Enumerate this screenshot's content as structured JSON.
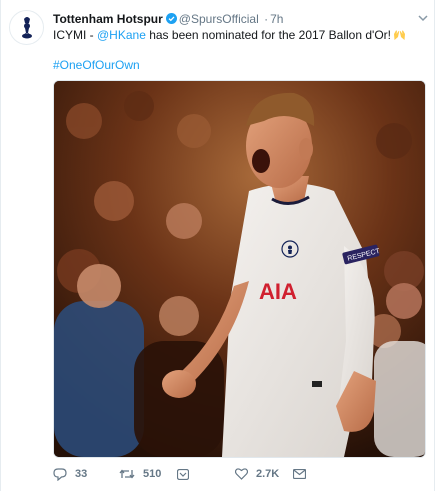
{
  "tweet": {
    "display_name": "Tottenham Hotspur",
    "handle": "@SpursOfficial",
    "separator": "·",
    "time": "7h",
    "text_prefix": "ICYMI - ",
    "mention": "@HKane",
    "text_suffix": " has been nominated for the 2017 Ballon d'Or!",
    "emoji_icon": "raised-hands-icon",
    "hashtag": "#OneOfOurOwn",
    "media": {
      "shirt_sponsor": "AIA",
      "sleeve_badge": "RESPECT"
    },
    "actions": {
      "reply_count": "33",
      "retweet_count": "510",
      "like_count": "2.7K"
    }
  },
  "colors": {
    "link": "#1da1f2",
    "muted": "#657786",
    "verified": "#1da1f2",
    "sponsor": "#d0202f"
  }
}
